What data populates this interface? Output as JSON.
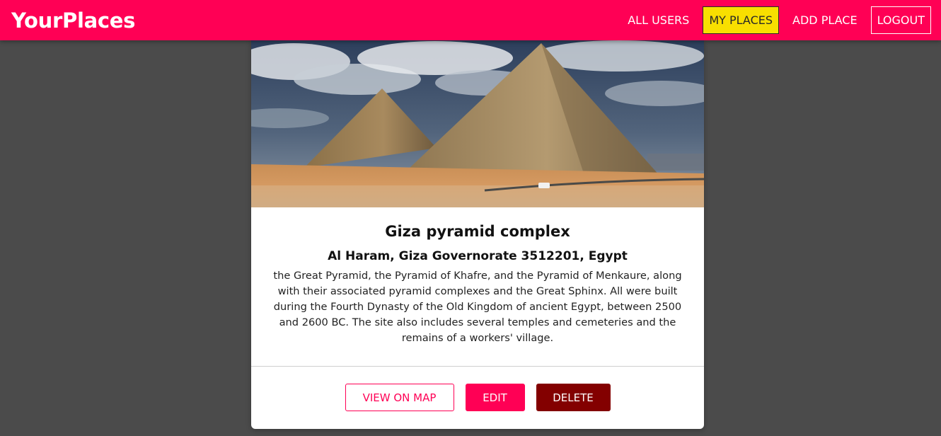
{
  "colors": {
    "header_bg": "#ff0055",
    "active_nav_bg": "#f8df00",
    "page_bg": "#4b4b4b",
    "danger": "#830000"
  },
  "header": {
    "logo": "YourPlaces",
    "nav": {
      "all_users": "ALL USERS",
      "my_places": "MY PLACES",
      "add_place": "ADD PLACE",
      "logout": "LOGOUT"
    }
  },
  "place": {
    "image_subject": "Giza pyramids photo",
    "title": "Giza pyramid complex",
    "address": "Al Haram, Giza Governorate 3512201, Egypt",
    "description": "the Great Pyramid, the Pyramid of Khafre, and the Pyramid of Menkaure, along with their associated pyramid complexes and the Great Sphinx. All were built during the Fourth Dynasty of the Old Kingdom of ancient Egypt, between 2500 and 2600 BC. The site also includes several temples and cemeteries and the remains of a workers' village."
  },
  "actions": {
    "view_on_map": "VIEW ON MAP",
    "edit": "EDIT",
    "delete": "DELETE"
  }
}
